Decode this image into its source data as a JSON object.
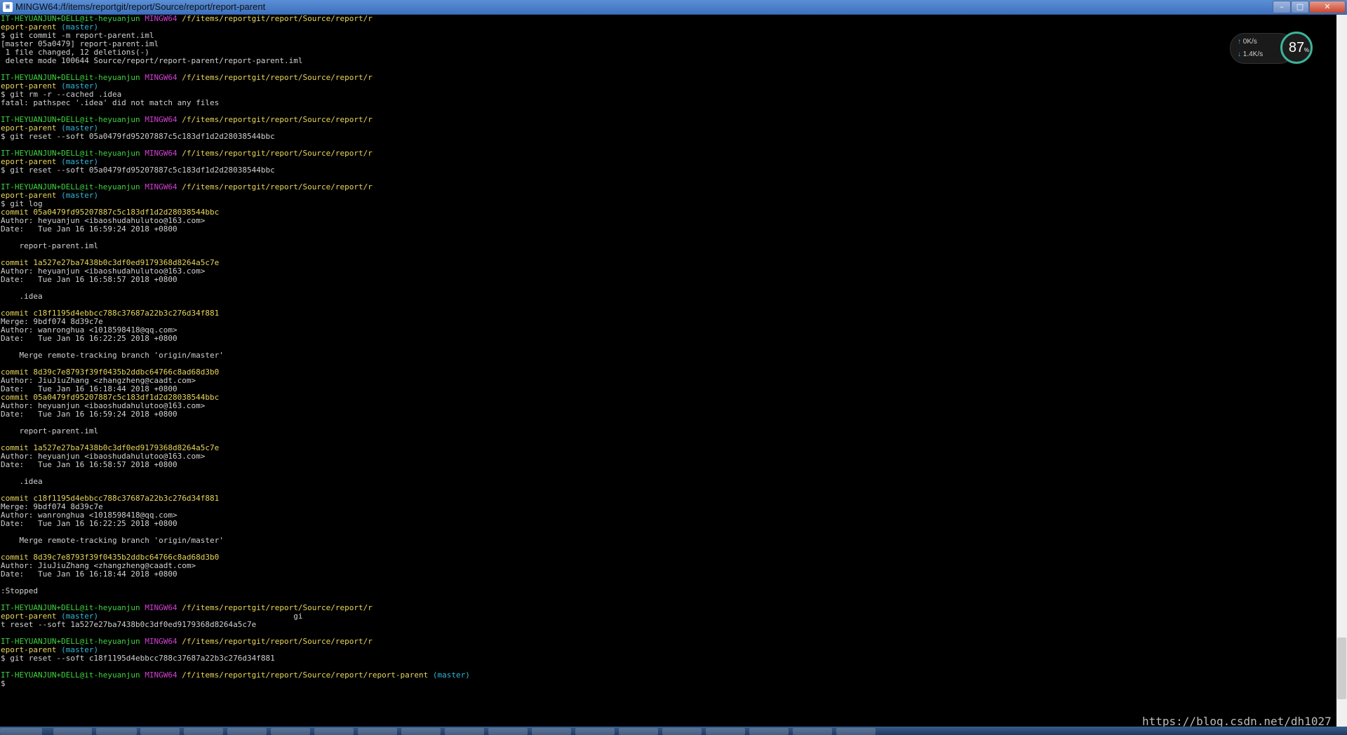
{
  "window": {
    "title": "MINGW64:/f/items/reportgit/report/Source/report/report-parent",
    "min_icon": "minimize-icon",
    "max_icon": "maximize-icon",
    "close_icon": "close-icon",
    "min_glyph": "–",
    "max_glyph": "□",
    "close_glyph": "✕"
  },
  "colors": {
    "prompt_user": "#3fd23f",
    "prompt_system": "#d040d0",
    "prompt_path": "#e8d65a",
    "branch": "#2fb8d8",
    "commit": "#e8d65a",
    "text": "#d0d0d0"
  },
  "terminal": {
    "lines": [
      [
        {
          "t": "IT-HEYUANJUN+DELL@it-heyuanjun ",
          "c": "green"
        },
        {
          "t": "MINGW64 ",
          "c": "magenta"
        },
        {
          "t": "/f/items/reportgit/report/Source/report/r",
          "c": "yellow"
        }
      ],
      [
        {
          "t": "eport-parent",
          "c": "yellow"
        },
        {
          "t": " (master)",
          "c": "cyan"
        }
      ],
      [
        {
          "t": "$ git commit -m report-parent.iml",
          "c": ""
        }
      ],
      [
        {
          "t": "[master 05a0479] report-parent.iml",
          "c": ""
        }
      ],
      [
        {
          "t": " 1 file changed, 12 deletions(-)",
          "c": ""
        }
      ],
      [
        {
          "t": " delete mode 100644 Source/report/report-parent/report-parent.iml",
          "c": ""
        }
      ],
      [
        {
          "t": "",
          "c": ""
        }
      ],
      [
        {
          "t": "IT-HEYUANJUN+DELL@it-heyuanjun ",
          "c": "green"
        },
        {
          "t": "MINGW64 ",
          "c": "magenta"
        },
        {
          "t": "/f/items/reportgit/report/Source/report/r",
          "c": "yellow"
        }
      ],
      [
        {
          "t": "eport-parent",
          "c": "yellow"
        },
        {
          "t": " (master)",
          "c": "cyan"
        }
      ],
      [
        {
          "t": "$ git rm -r --cached .idea",
          "c": ""
        }
      ],
      [
        {
          "t": "fatal: pathspec '.idea' did not match any files",
          "c": ""
        }
      ],
      [
        {
          "t": "",
          "c": ""
        }
      ],
      [
        {
          "t": "IT-HEYUANJUN+DELL@it-heyuanjun ",
          "c": "green"
        },
        {
          "t": "MINGW64 ",
          "c": "magenta"
        },
        {
          "t": "/f/items/reportgit/report/Source/report/r",
          "c": "yellow"
        }
      ],
      [
        {
          "t": "eport-parent",
          "c": "yellow"
        },
        {
          "t": " (master)",
          "c": "cyan"
        }
      ],
      [
        {
          "t": "$ git reset --soft 05a0479fd95207887c5c183df1d2d28038544bbc",
          "c": ""
        }
      ],
      [
        {
          "t": "",
          "c": ""
        }
      ],
      [
        {
          "t": "IT-HEYUANJUN+DELL@it-heyuanjun ",
          "c": "green"
        },
        {
          "t": "MINGW64 ",
          "c": "magenta"
        },
        {
          "t": "/f/items/reportgit/report/Source/report/r",
          "c": "yellow"
        }
      ],
      [
        {
          "t": "eport-parent",
          "c": "yellow"
        },
        {
          "t": " (master)",
          "c": "cyan"
        }
      ],
      [
        {
          "t": "$ git reset --soft 05a0479fd95207887c5c183df1d2d28038544bbc",
          "c": ""
        }
      ],
      [
        {
          "t": "",
          "c": ""
        }
      ],
      [
        {
          "t": "IT-HEYUANJUN+DELL@it-heyuanjun ",
          "c": "green"
        },
        {
          "t": "MINGW64 ",
          "c": "magenta"
        },
        {
          "t": "/f/items/reportgit/report/Source/report/r",
          "c": "yellow"
        }
      ],
      [
        {
          "t": "eport-parent",
          "c": "yellow"
        },
        {
          "t": " (master)",
          "c": "cyan"
        }
      ],
      [
        {
          "t": "$ git log",
          "c": ""
        }
      ],
      [
        {
          "t": "commit 05a0479fd95207887c5c183df1d2d28038544bbc",
          "c": "yellow"
        }
      ],
      [
        {
          "t": "Author: heyuanjun <ibaoshudahulutoo@163.com>",
          "c": ""
        }
      ],
      [
        {
          "t": "Date:   Tue Jan 16 16:59:24 2018 +0800",
          "c": ""
        }
      ],
      [
        {
          "t": "",
          "c": ""
        }
      ],
      [
        {
          "t": "    report-parent.iml",
          "c": ""
        }
      ],
      [
        {
          "t": "",
          "c": ""
        }
      ],
      [
        {
          "t": "commit 1a527e27ba7438b0c3df0ed9179368d8264a5c7e",
          "c": "yellow"
        }
      ],
      [
        {
          "t": "Author: heyuanjun <ibaoshudahulutoo@163.com>",
          "c": ""
        }
      ],
      [
        {
          "t": "Date:   Tue Jan 16 16:58:57 2018 +0800",
          "c": ""
        }
      ],
      [
        {
          "t": "",
          "c": ""
        }
      ],
      [
        {
          "t": "    .idea",
          "c": ""
        }
      ],
      [
        {
          "t": "",
          "c": ""
        }
      ],
      [
        {
          "t": "commit c18f1195d4ebbcc788c37687a22b3c276d34f881",
          "c": "yellow"
        }
      ],
      [
        {
          "t": "Merge: 9bdf074 8d39c7e",
          "c": ""
        }
      ],
      [
        {
          "t": "Author: wanronghua <1018598418@qq.com>",
          "c": ""
        }
      ],
      [
        {
          "t": "Date:   Tue Jan 16 16:22:25 2018 +0800",
          "c": ""
        }
      ],
      [
        {
          "t": "",
          "c": ""
        }
      ],
      [
        {
          "t": "    Merge remote-tracking branch 'origin/master'",
          "c": ""
        }
      ],
      [
        {
          "t": "",
          "c": ""
        }
      ],
      [
        {
          "t": "commit 8d39c7e8793f39f0435b2ddbc64766c8ad68d3b0",
          "c": "yellow"
        }
      ],
      [
        {
          "t": "Author: JiuJiuZhang <zhangzheng@caadt.com>",
          "c": ""
        }
      ],
      [
        {
          "t": "Date:   Tue Jan 16 16:18:44 2018 +0800",
          "c": ""
        }
      ],
      [
        {
          "t": "commit 05a0479fd95207887c5c183df1d2d28038544bbc",
          "c": "yellow"
        }
      ],
      [
        {
          "t": "Author: heyuanjun <ibaoshudahulutoo@163.com>",
          "c": ""
        }
      ],
      [
        {
          "t": "Date:   Tue Jan 16 16:59:24 2018 +0800",
          "c": ""
        }
      ],
      [
        {
          "t": "",
          "c": ""
        }
      ],
      [
        {
          "t": "    report-parent.iml",
          "c": ""
        }
      ],
      [
        {
          "t": "",
          "c": ""
        }
      ],
      [
        {
          "t": "commit 1a527e27ba7438b0c3df0ed9179368d8264a5c7e",
          "c": "yellow"
        }
      ],
      [
        {
          "t": "Author: heyuanjun <ibaoshudahulutoo@163.com>",
          "c": ""
        }
      ],
      [
        {
          "t": "Date:   Tue Jan 16 16:58:57 2018 +0800",
          "c": ""
        }
      ],
      [
        {
          "t": "",
          "c": ""
        }
      ],
      [
        {
          "t": "    .idea",
          "c": ""
        }
      ],
      [
        {
          "t": "",
          "c": ""
        }
      ],
      [
        {
          "t": "commit c18f1195d4ebbcc788c37687a22b3c276d34f881",
          "c": "yellow"
        }
      ],
      [
        {
          "t": "Merge: 9bdf074 8d39c7e",
          "c": ""
        }
      ],
      [
        {
          "t": "Author: wanronghua <1018598418@qq.com>",
          "c": ""
        }
      ],
      [
        {
          "t": "Date:   Tue Jan 16 16:22:25 2018 +0800",
          "c": ""
        }
      ],
      [
        {
          "t": "",
          "c": ""
        }
      ],
      [
        {
          "t": "    Merge remote-tracking branch 'origin/master'",
          "c": ""
        }
      ],
      [
        {
          "t": "",
          "c": ""
        }
      ],
      [
        {
          "t": "commit 8d39c7e8793f39f0435b2ddbc64766c8ad68d3b0",
          "c": "yellow"
        }
      ],
      [
        {
          "t": "Author: JiuJiuZhang <zhangzheng@caadt.com>",
          "c": ""
        }
      ],
      [
        {
          "t": "Date:   Tue Jan 16 16:18:44 2018 +0800",
          "c": ""
        }
      ],
      [
        {
          "t": "",
          "c": ""
        }
      ],
      [
        {
          "t": ":Stopped",
          "c": ""
        }
      ],
      [
        {
          "t": "",
          "c": ""
        }
      ],
      [
        {
          "t": "IT-HEYUANJUN+DELL@it-heyuanjun ",
          "c": "green"
        },
        {
          "t": "MINGW64 ",
          "c": "magenta"
        },
        {
          "t": "/f/items/reportgit/report/Source/report/r",
          "c": "yellow"
        }
      ],
      [
        {
          "t": "eport-parent",
          "c": "yellow"
        },
        {
          "t": " (master)",
          "c": "cyan"
        },
        {
          "t": "                                          gi",
          "c": ""
        }
      ],
      [
        {
          "t": "t reset --soft 1a527e27ba7438b0c3df0ed9179368d8264a5c7e",
          "c": ""
        }
      ],
      [
        {
          "t": "",
          "c": ""
        }
      ],
      [
        {
          "t": "IT-HEYUANJUN+DELL@it-heyuanjun ",
          "c": "green"
        },
        {
          "t": "MINGW64 ",
          "c": "magenta"
        },
        {
          "t": "/f/items/reportgit/report/Source/report/r",
          "c": "yellow"
        }
      ],
      [
        {
          "t": "eport-parent",
          "c": "yellow"
        },
        {
          "t": " (master)",
          "c": "cyan"
        }
      ],
      [
        {
          "t": "$ git reset --soft c18f1195d4ebbcc788c37687a22b3c276d34f881",
          "c": ""
        }
      ],
      [
        {
          "t": "",
          "c": ""
        }
      ],
      [
        {
          "t": "IT-HEYUANJUN+DELL@it-heyuanjun ",
          "c": "green"
        },
        {
          "t": "MINGW64 ",
          "c": "magenta"
        },
        {
          "t": "/f/items/reportgit/report/Source/report/report-parent",
          "c": "yellow"
        },
        {
          "t": " (master)",
          "c": "cyan"
        }
      ],
      [
        {
          "t": "$",
          "c": ""
        }
      ]
    ]
  },
  "net_widget": {
    "up_arrow": "↑",
    "down_arrow": "↓",
    "up_speed": "0K/s",
    "down_speed": "1.4K/s",
    "cpu_percent": "87",
    "cpu_unit": "%"
  },
  "watermark": "https://blog.csdn.net/dh1027"
}
